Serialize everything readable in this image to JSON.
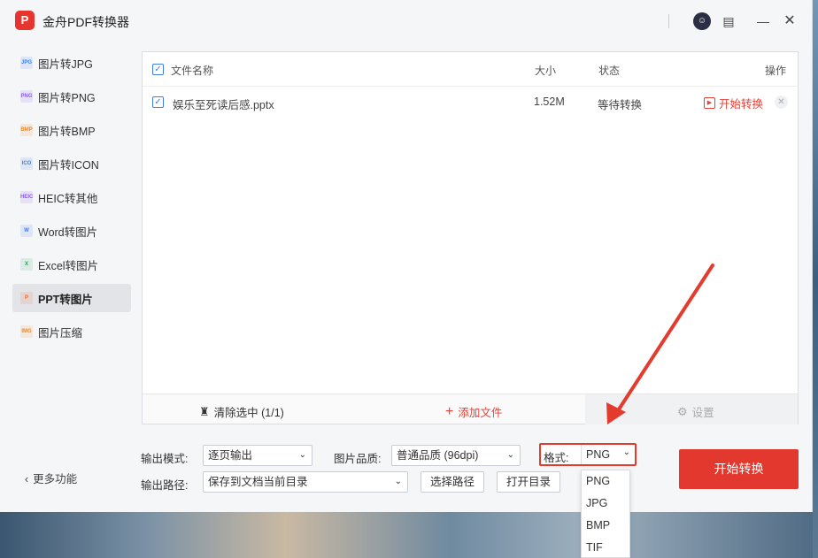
{
  "app": {
    "logo_text": "P",
    "title": "金舟PDF转换器"
  },
  "titlebar_icons": [
    "avatar-icon",
    "note-icon",
    "minimize-icon",
    "close-icon"
  ],
  "sidebar": {
    "items": [
      {
        "label": "图片转JPG",
        "icon": "JPG",
        "color": "#3f7ee8"
      },
      {
        "label": "图片转PNG",
        "icon": "PNG",
        "color": "#8b5cf6"
      },
      {
        "label": "图片转BMP",
        "icon": "BMP",
        "color": "#f08a24"
      },
      {
        "label": "图片转ICON",
        "icon": "ICO",
        "color": "#3f7ee8"
      },
      {
        "label": "HEIC转其他",
        "icon": "HEIC",
        "color": "#8b5cf6"
      },
      {
        "label": "Word转图片",
        "icon": "W",
        "color": "#3f7ee8"
      },
      {
        "label": "Excel转图片",
        "icon": "X",
        "color": "#22a35a"
      },
      {
        "label": "PPT转图片",
        "icon": "P",
        "color": "#f06a24"
      },
      {
        "label": "图片压缩",
        "icon": "IMG",
        "color": "#f08a24"
      }
    ],
    "active_index": 7,
    "more": "更多功能"
  },
  "table": {
    "headers": {
      "name": "文件名称",
      "size": "大小",
      "status": "状态",
      "action": "操作"
    },
    "rows": [
      {
        "name": "娱乐至死读后感.pptx",
        "size": "1.52M",
        "status": "等待转换",
        "action": "开始转换"
      }
    ]
  },
  "bottom_bar": {
    "clear": "清除选中 (1/1)",
    "add": "添加文件",
    "settings": "设置"
  },
  "output": {
    "mode_label": "输出模式:",
    "mode_value": "逐页输出",
    "quality_label": "图片品质:",
    "quality_value": "普通品质 (96dpi)",
    "format_label": "格式:",
    "format_value": "PNG",
    "path_label": "输出路径:",
    "path_value": "保存到文档当前目录",
    "choose_path": "选择路径",
    "open_dir": "打开目录"
  },
  "format_options": [
    "PNG",
    "JPG",
    "BMP",
    "TIF"
  ],
  "start_button": "开始转换",
  "colors": {
    "accent_red": "#e3382d",
    "checkbox_blue": "#3f7ee8"
  }
}
